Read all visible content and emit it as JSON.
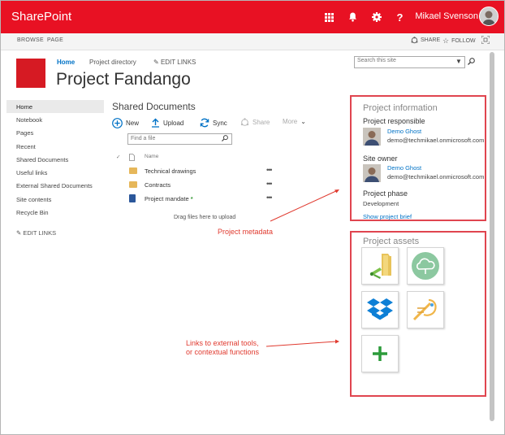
{
  "suite": {
    "brand": "SharePoint",
    "user_name": "Mikael Svenson"
  },
  "ribbon": {
    "tab_browse": "BROWSE",
    "tab_page": "PAGE",
    "share_label": "SHARE",
    "follow_label": "FOLLOW"
  },
  "header": {
    "site_title": "Project Fandango",
    "nav": [
      "Home",
      "Project directory"
    ],
    "edit_links": "EDIT LINKS",
    "search_placeholder": "Search this site"
  },
  "left_nav": {
    "items": [
      "Home",
      "Notebook",
      "Pages",
      "Recent",
      "Shared Documents",
      "Useful links",
      "External Shared Documents",
      "Site contents",
      "Recycle Bin"
    ],
    "selected": "Home",
    "edit_links": "EDIT LINKS"
  },
  "library": {
    "title": "Shared Documents",
    "toolbar": {
      "new": "New",
      "upload": "Upload",
      "sync": "Sync",
      "share": "Share",
      "more": "More"
    },
    "find_placeholder": "Find a file",
    "column_name": "Name",
    "rows": [
      {
        "name": "Technical drawings",
        "type": "folder"
      },
      {
        "name": "Contracts",
        "type": "folder"
      },
      {
        "name": "Project mandate",
        "type": "doc",
        "new_marker": "*"
      }
    ],
    "drag_hint": "Drag files here to upload"
  },
  "project_info": {
    "title": "Project information",
    "responsible_label": "Project responsible",
    "responsible_name": "Demo Ghost",
    "responsible_email": "demo@techmikael.onmicrosoft.com",
    "owner_label": "Site owner",
    "owner_name": "Demo Ghost",
    "owner_email": "demo@techmikael.onmicrosoft.com",
    "phase_label": "Project phase",
    "phase_value": "Development",
    "brief_link": "Show project brief"
  },
  "project_assets": {
    "title": "Project assets",
    "tiles": [
      "folder-sync-tool",
      "cloud-tool",
      "dropbox-tool",
      "workflow-tool",
      "add-tool"
    ]
  },
  "annotations": {
    "metadata": "Project metadata",
    "links_line1": "Links to external tools,",
    "links_line2": "or contextual functions"
  },
  "colors": {
    "accent": "#e81123",
    "link": "#0072c6",
    "annotation": "#e03a2f"
  }
}
